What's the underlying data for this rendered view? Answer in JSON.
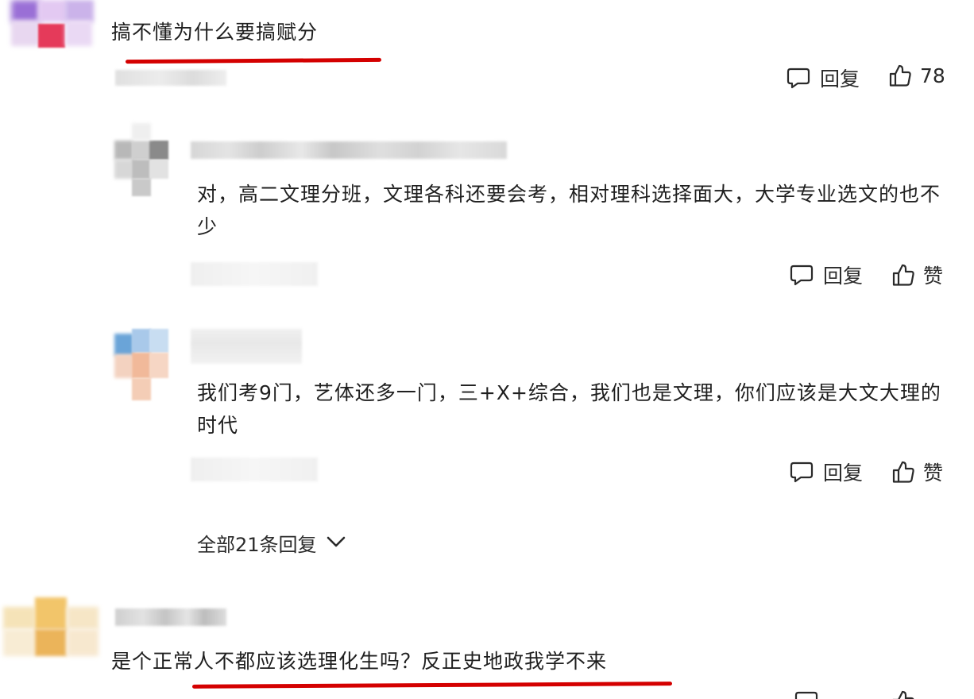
{
  "comments": [
    {
      "text": "搞不懂为什么要搞赋分",
      "reply_label": "回复",
      "like_count": "78"
    },
    {
      "text": "对，高二文理分班，文理各科还要会考，相对理科选择面大，大学专业选文的也不少",
      "reply_label": "回复",
      "like_label": "赞"
    },
    {
      "text": "我们考9门，艺体还多一门，三+X+综合，我们也是文理，你们应该是大文大理的时代",
      "reply_label": "回复",
      "like_label": "赞"
    },
    {
      "text": "是个正常人不都应该选理化生吗？反正史地政我学不来"
    }
  ],
  "expand_replies_label": "全部21条回复",
  "colors": {
    "highlight_underline": "#d40000"
  }
}
